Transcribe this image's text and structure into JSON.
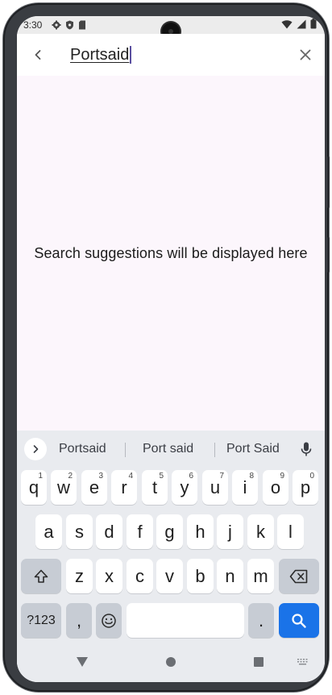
{
  "status_bar": {
    "time": "3:30",
    "left_icons": [
      "gear-icon",
      "shield-icon",
      "sim-card-icon"
    ],
    "right_icons": [
      "wifi-icon",
      "signal-icon",
      "battery-icon"
    ]
  },
  "app_bar": {
    "search_value": "Portsaid"
  },
  "content": {
    "empty_message": "Search suggestions will be displayed here"
  },
  "keyboard": {
    "suggestions": [
      "Portsaid",
      "Port said",
      "Port Said"
    ],
    "row1": [
      {
        "key": "q",
        "hint": "1"
      },
      {
        "key": "w",
        "hint": "2"
      },
      {
        "key": "e",
        "hint": "3"
      },
      {
        "key": "r",
        "hint": "4"
      },
      {
        "key": "t",
        "hint": "5"
      },
      {
        "key": "y",
        "hint": "6"
      },
      {
        "key": "u",
        "hint": "7"
      },
      {
        "key": "i",
        "hint": "8"
      },
      {
        "key": "o",
        "hint": "9"
      },
      {
        "key": "p",
        "hint": "0"
      }
    ],
    "row2": [
      "a",
      "s",
      "d",
      "f",
      "g",
      "h",
      "j",
      "k",
      "l"
    ],
    "row3": [
      "z",
      "x",
      "c",
      "v",
      "b",
      "n",
      "m"
    ],
    "symbols_label": "?123",
    "comma_label": ",",
    "period_label": ".",
    "action_color": "#1a73e8"
  },
  "nav_bar": {
    "icons": [
      "back-triangle-icon",
      "home-circle-icon",
      "recents-square-icon",
      "keyboard-switch-icon"
    ]
  }
}
